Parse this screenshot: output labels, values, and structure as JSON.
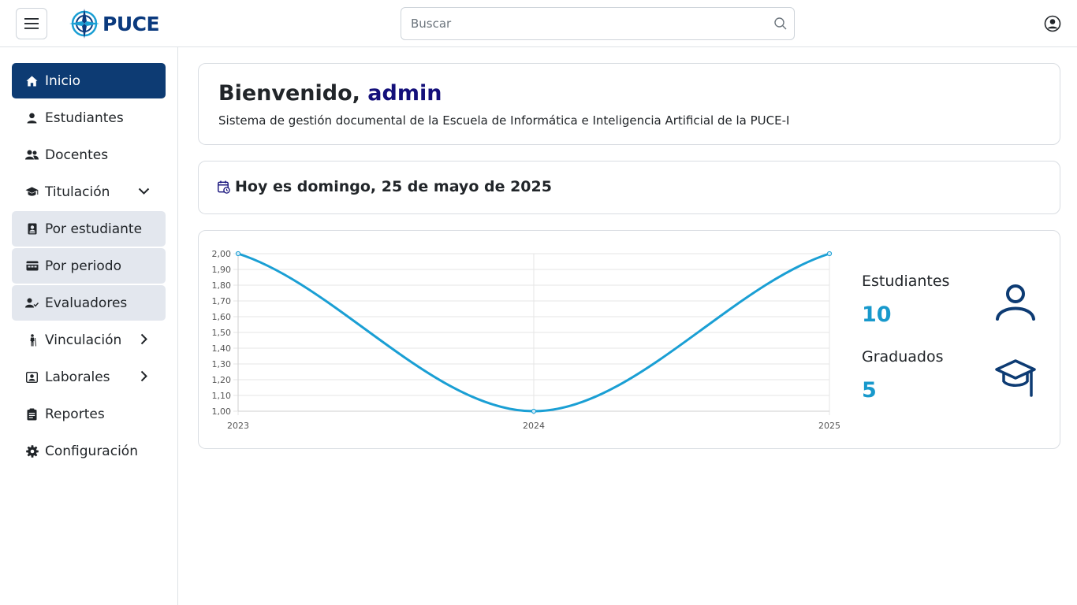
{
  "header": {
    "logo_text": "PUCE",
    "search_placeholder": "Buscar"
  },
  "sidebar": {
    "items": [
      {
        "label": "Inicio",
        "icon": "home-icon",
        "state": "active"
      },
      {
        "label": "Estudiantes",
        "icon": "person-icon"
      },
      {
        "label": "Docentes",
        "icon": "people-icon"
      },
      {
        "label": "Titulación",
        "icon": "graduation-cap-icon",
        "expanded": true
      },
      {
        "label": "Por estudiante",
        "icon": "student-file-icon",
        "state": "sub"
      },
      {
        "label": "Por periodo",
        "icon": "calendar-card-icon",
        "state": "sub"
      },
      {
        "label": "Evaluadores",
        "icon": "person-check-icon",
        "state": "sub"
      },
      {
        "label": "Vinculación",
        "icon": "walking-person-icon",
        "expanded": false
      },
      {
        "label": "Laborales",
        "icon": "id-badge-icon",
        "expanded": false
      },
      {
        "label": "Reportes",
        "icon": "clipboard-icon"
      },
      {
        "label": "Configuración",
        "icon": "gear-icon"
      }
    ]
  },
  "welcome": {
    "greeting": "Bienvenido,",
    "username": "admin",
    "subtitle": "Sistema de gestión documental de la Escuela de Informática e Inteligencia Artificial de la PUCE-I"
  },
  "date_banner": {
    "text": "Hoy es domingo, 25 de mayo de 2025"
  },
  "stats": {
    "students_label": "Estudiantes",
    "students_value": "10",
    "graduates_label": "Graduados",
    "graduates_value": "5"
  },
  "colors": {
    "primary": "#0d3b73",
    "accent": "#1899cc",
    "line": "#1a9fd4",
    "username": "#130f7a"
  },
  "chart_data": {
    "type": "line",
    "categories": [
      "2023",
      "2024",
      "2025"
    ],
    "series": [
      {
        "values": [
          2.0,
          1.0,
          2.0
        ]
      }
    ],
    "ylim": [
      1.0,
      2.0
    ],
    "yticks": [
      "2,00",
      "1,90",
      "1,80",
      "1,70",
      "1,60",
      "1,50",
      "1,40",
      "1,30",
      "1,20",
      "1,10",
      "1,00"
    ],
    "grid": true,
    "smooth": true
  }
}
